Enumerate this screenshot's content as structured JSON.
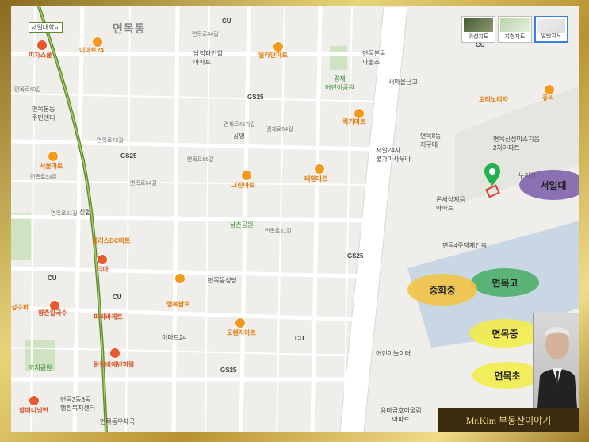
{
  "map_type_buttons": [
    {
      "label": "위성지도",
      "active": false
    },
    {
      "label": "지형지도",
      "active": false
    },
    {
      "label": "일반지도",
      "active": true
    }
  ],
  "district": "면목동",
  "station_label": "서일대학교",
  "labels": {
    "myeonmokbondong_jumin": "면목본동\n주민센터",
    "myeonmok4": "면목4주택재건축",
    "myeonmok3_8": "면목3동8동\n행정복지센터",
    "myeonmok_post": "면목동우체국",
    "myeonmok_church": "면목동성당",
    "namjeong": "남정파인힐\n아파트",
    "onsejium": "온세상지음\n아파트",
    "sindongmi": "면목신성미소지움\n2차아파트",
    "myeonmok8": "면목8동\n지구대",
    "seoil24": "서일24시\n불가마사우나",
    "daycare": "어린이놀이터",
    "yongma": "용마금호어울림\n아파트",
    "gyeongjae": "겸재\n어린이공원",
    "paechul": "면목본동\n파출소",
    "saemaul": "새마을금고",
    "gongwon": "공영",
    "namchon": "남촌공원",
    "kkachi": "까치공원",
    "sinseong": "신협",
    "nupyeong": "누리원",
    "dorinoli": "도리노리"
  },
  "pois": {
    "emart24_a": "이마트24",
    "emart24_b": "이마트24",
    "pizza": "피자스쿨",
    "allda": "일라단마트",
    "lucky": "럭키마트",
    "seoul": "서울마트",
    "green": "그린마트",
    "taeyang": "태양마트",
    "onds": "플러스DC마트",
    "tia": "티아",
    "haengbok": "행복팜트",
    "ohyeon": "오렌지마트",
    "hyangchon": "향촌칼국수",
    "paris": "파리바게트",
    "dakgalbi": "닭갈비예반하닭",
    "halmeoni": "할머니냉면",
    "suseong": "성수퍼",
    "jusi": "쥬씨",
    "dorinori": "도리노리자"
  },
  "conv_stores": [
    "GS25",
    "GS25",
    "GS25",
    "GS25",
    "CU",
    "CU",
    "CU",
    "CU",
    "CU"
  ],
  "streets": [
    "면목로40길",
    "면목로53길",
    "면목로61길",
    "면목로73길",
    "면목로66길",
    "면목로64길",
    "면목로81길",
    "겸재로54길",
    "겸재로43가길",
    "면목로44길"
  ],
  "schools": [
    {
      "label": "서일대",
      "color": "#7a5aa8"
    },
    {
      "label": "면목고",
      "color": "#4caf6a"
    },
    {
      "label": "중화중",
      "color": "#f1c445"
    },
    {
      "label": "면목중",
      "color": "#f2ec4a"
    },
    {
      "label": "면목초",
      "color": "#f2ec4a"
    }
  ],
  "banner": "Mr.Kim 부동산이야기",
  "accent": "#caa94a"
}
